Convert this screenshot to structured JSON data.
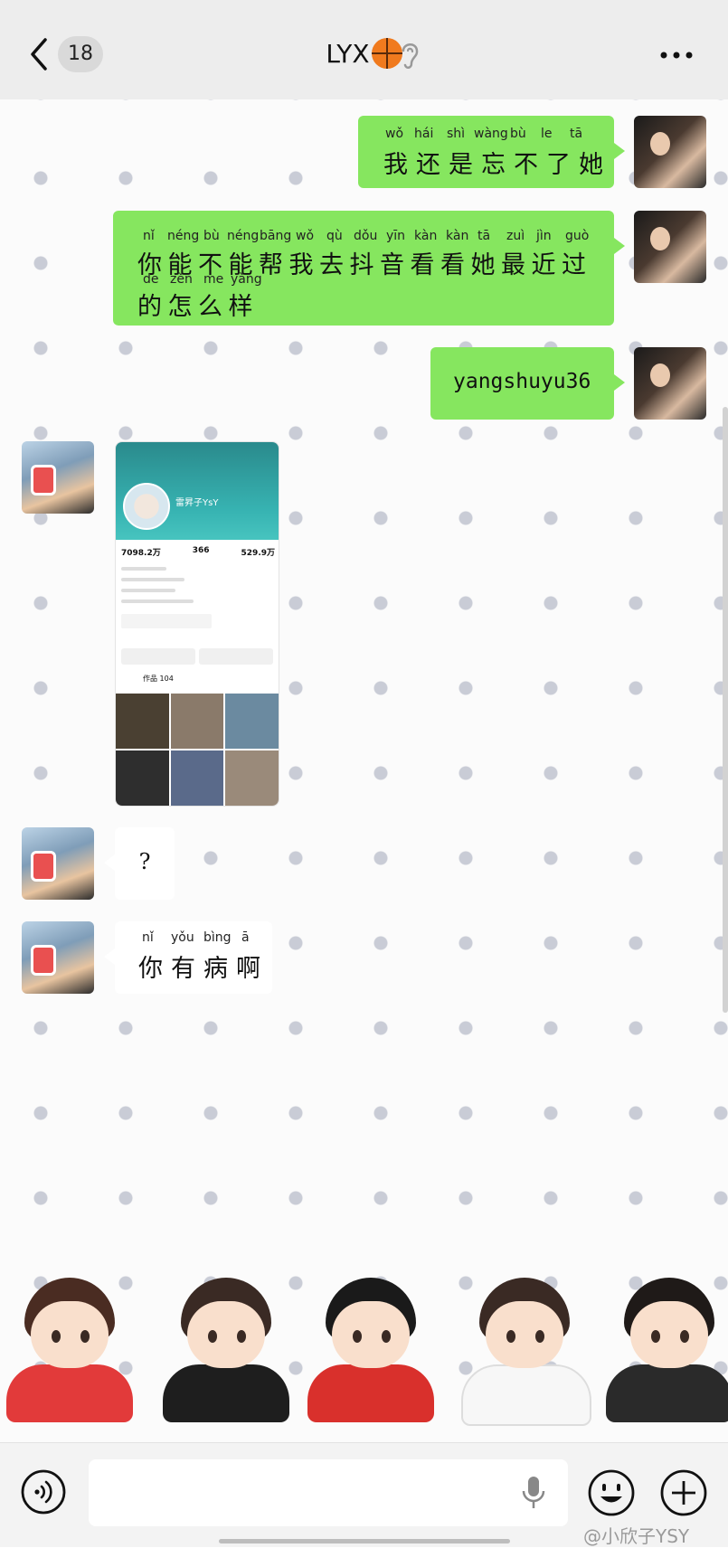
{
  "header": {
    "unread_count": "18",
    "contact_name": "LYX",
    "contact_emoji_icon": "basketball-icon",
    "ear_icon": "ear-icon",
    "more_icon": "more-icon"
  },
  "messages": [
    {
      "from": "me",
      "type": "text",
      "pinyin": [
        "wǒ",
        "hái",
        "shì",
        "wàng",
        "bù",
        "le",
        "tā"
      ],
      "text": "我还是忘不了她"
    },
    {
      "from": "me",
      "type": "text",
      "pinyin_line1": [
        "nǐ",
        "néng",
        "bù",
        "néng",
        "bāng",
        "wǒ",
        "qù",
        "dǒu",
        "yīn",
        "kàn",
        "kàn",
        "tā",
        "zuì",
        "jìn",
        "guò"
      ],
      "text_line1": "你能不能帮我去抖音看看她最近过",
      "pinyin_line2": [
        "de",
        "zěn",
        "me",
        "yàng"
      ],
      "text_line2": "的怎么样"
    },
    {
      "from": "me",
      "type": "text",
      "text": "yangshuyu36"
    },
    {
      "from": "her",
      "type": "image",
      "shot": {
        "name": "雷昇子YsY",
        "stat1": "7098.2万",
        "stat2": "366",
        "stat3": "529.9万",
        "tab": "作品 104"
      }
    },
    {
      "from": "her",
      "type": "text",
      "text": "?"
    },
    {
      "from": "her",
      "type": "text",
      "pinyin": [
        "nǐ",
        "yǒu",
        "bìng",
        "ā"
      ],
      "text": "你有病啊"
    }
  ],
  "stickers": [
    "sticker-kid-red",
    "sticker-kid-black",
    "sticker-kid-china",
    "sticker-kid-white",
    "sticker-kid-dark"
  ],
  "input": {
    "placeholder": "",
    "voice_icon": "voice-icon",
    "mic_icon": "mic-icon",
    "emoji_icon": "emoji-icon",
    "plus_icon": "plus-icon"
  },
  "watermark": "@小欣子YSY",
  "colors": {
    "my_bubble": "#86e65f",
    "header_bg": "#ededed"
  }
}
